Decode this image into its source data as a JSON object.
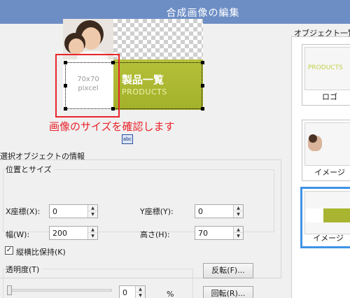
{
  "window": {
    "title": "合成画像の編集"
  },
  "canvas": {
    "placeholder_line1": "70x70",
    "placeholder_line2": "pixcel",
    "banner_jp": "製品一覧",
    "banner_en": "PRODUCTS",
    "annotation": "画像のサイズを確認します",
    "annotation_color": "#e8242b",
    "accent_color": "#a9b530",
    "text_tag": "abc"
  },
  "info": {
    "section_title": "選択オブジェクトの情報",
    "position_group": "位置とサイズ",
    "x_label": "X座標(X):",
    "x_value": "0",
    "y_label": "Y座標(Y):",
    "y_value": "0",
    "width_label": "幅(W):",
    "width_value": "200",
    "height_label": "高さ(H):",
    "height_value": "70",
    "keep_ratio_label": "縦横比保持(K)",
    "keep_ratio_checked": true,
    "opacity_group": "透明度(T)",
    "opacity_value": "0",
    "opacity_unit": "%",
    "flip_button": "反転(F)...",
    "rotate_button": "回転(R)..."
  },
  "objects_panel": {
    "title": "オブジェクト一覧",
    "items": [
      {
        "caption": "ロゴ",
        "thumb_text": "PRODUCTS",
        "icon": "logo-thumbnail",
        "selected": false
      },
      {
        "caption": "イメージ",
        "icon": "photo-thumbnail",
        "selected": false
      },
      {
        "caption": "イメージ",
        "icon": "banner-thumbnail",
        "selected": true
      }
    ]
  }
}
